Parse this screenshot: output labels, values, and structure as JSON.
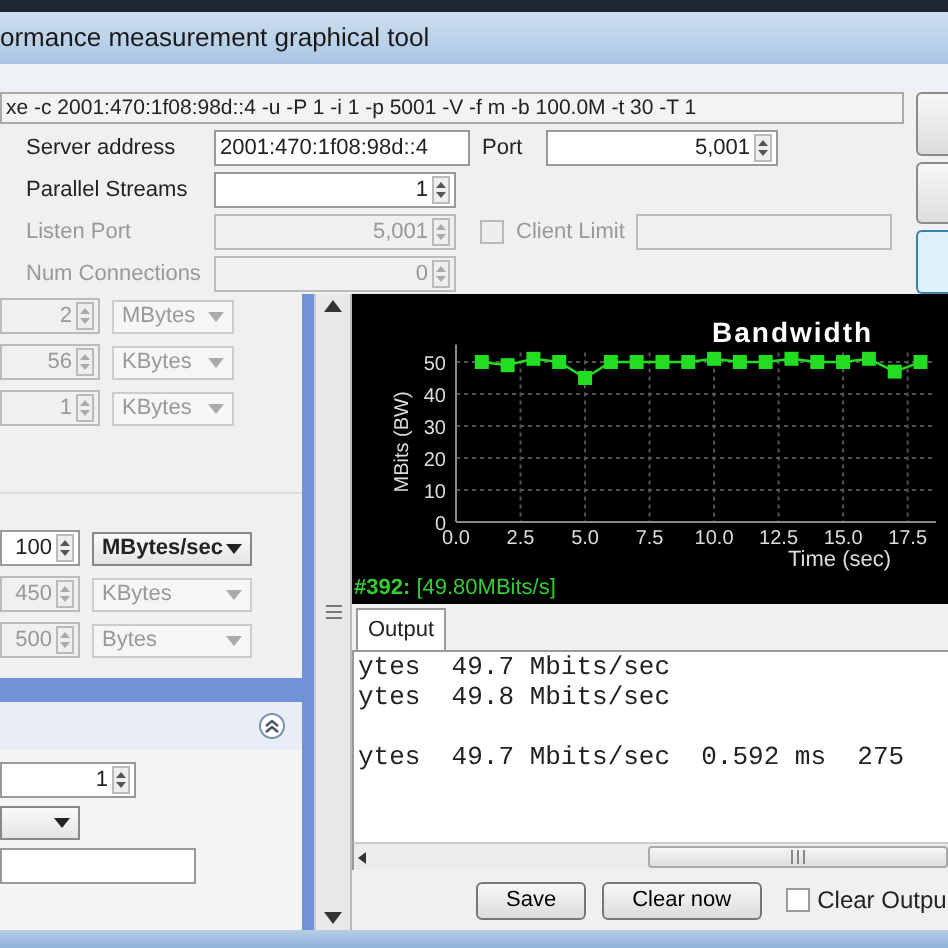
{
  "window": {
    "title": "ormance measurement graphical tool"
  },
  "command_line": "xe -c 2001:470:1f08:98d::4 -u -P 1 -i 1 -p 5001 -V -f m -b 100.0M -t 30 -T 1",
  "form": {
    "server_address": {
      "label": "Server address",
      "value": "2001:470:1f08:98d::4"
    },
    "port": {
      "label": "Port",
      "value": "5,001"
    },
    "parallel_streams": {
      "label": "Parallel Streams",
      "value": "1"
    },
    "listen_port": {
      "label": "Listen Port",
      "value": "5,001",
      "disabled": true
    },
    "client_limit": {
      "label": "Client Limit",
      "checked": false,
      "disabled": true
    },
    "num_connections": {
      "label": "Num Connections",
      "value": "0",
      "disabled": true
    }
  },
  "left_panel": {
    "settings": [
      {
        "value": "2",
        "unit": "MBytes",
        "disabled": true
      },
      {
        "value": "56",
        "unit": "KBytes",
        "disabled": true
      },
      {
        "value": "1",
        "unit": "KBytes",
        "disabled": true
      }
    ],
    "rate_settings": [
      {
        "value": "100",
        "unit": "MBytes/sec",
        "disabled": false
      },
      {
        "value": "450",
        "unit": "KBytes",
        "disabled": true
      },
      {
        "value": "500",
        "unit": "Bytes",
        "disabled": true
      }
    ],
    "lower_section": {
      "expanded": true,
      "spinner_value": "1"
    }
  },
  "chart": {
    "chart_data": {
      "type": "line",
      "title": "Bandwidth",
      "xlabel": "Time (sec)",
      "ylabel": "MBits (BW)",
      "x": [
        1,
        2,
        3,
        4,
        5,
        6,
        7,
        8,
        9,
        10,
        11,
        12,
        13,
        14,
        15,
        16,
        17,
        18
      ],
      "series": [
        {
          "color": "#22dd22",
          "marker": "square",
          "values": [
            50,
            49,
            51,
            50,
            45,
            50,
            50,
            50,
            50,
            51,
            50,
            50,
            51,
            50,
            50,
            51,
            47,
            50
          ]
        }
      ],
      "grid": true,
      "xlim": [
        0,
        18.6
      ],
      "ylim": [
        0,
        53
      ],
      "xticks": [
        {
          "value": 0,
          "label": "0.0"
        },
        {
          "value": 2.5,
          "label": "2.5"
        },
        {
          "value": 5,
          "label": "5.0"
        },
        {
          "value": 7.5,
          "label": "7.5"
        },
        {
          "value": 10,
          "label": "10.0"
        },
        {
          "value": 12.5,
          "label": "12.5"
        },
        {
          "value": 15,
          "label": "15.0"
        },
        {
          "value": 17.5,
          "label": "17.5"
        }
      ],
      "yticks": [
        0,
        10,
        20,
        30,
        40,
        50
      ]
    },
    "status": {
      "index": "#392:",
      "reading": "[49.80MBits/s]"
    }
  },
  "output": {
    "tab": {
      "label": "Output",
      "selected": true
    },
    "blocks": [
      [
        "ytes  49.7 Mbits/sec",
        "ytes  49.8 Mbits/sec"
      ],
      [
        "ytes  49.7 Mbits/sec  0.592 ms  275"
      ]
    ],
    "buttons": [
      "Save",
      "Clear now"
    ],
    "clear_output": {
      "label": "Clear Outpu",
      "checked": false
    }
  }
}
